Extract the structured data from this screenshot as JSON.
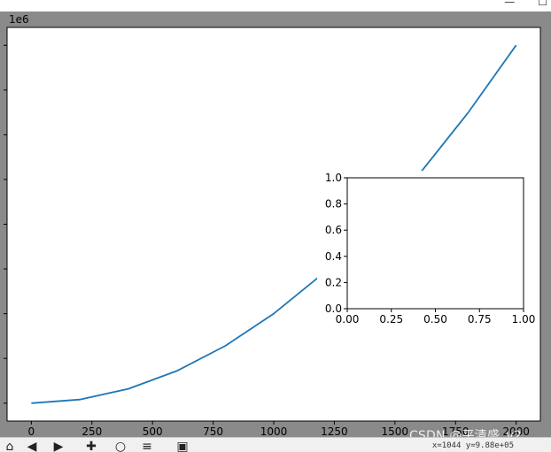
{
  "window": {
    "title": "​​​​",
    "controls": [
      "—",
      "☐"
    ]
  },
  "toolbar": {
    "buttons": [
      {
        "name": "home-icon",
        "glyph": "⌂"
      },
      {
        "name": "back-icon",
        "glyph": "◀"
      },
      {
        "name": "forward-icon",
        "glyph": "▶"
      },
      {
        "name": "pan-icon",
        "glyph": "✚"
      },
      {
        "name": "zoom-icon",
        "glyph": "○"
      },
      {
        "name": "configure-subplots-icon",
        "glyph": "≡"
      },
      {
        "name": "save-icon",
        "glyph": "▣"
      }
    ],
    "coord_text": "x=1044  y=9.88e+05"
  },
  "watermark": "CSDN @平清盛_v2",
  "chart_data": [
    {
      "type": "line",
      "x_ticks": [
        0,
        250,
        500,
        750,
        1000,
        1250,
        1500,
        1750,
        2000
      ],
      "x_tick_labels": [
        "0",
        "250",
        "500",
        "750",
        "1000",
        "1250",
        "1500",
        "1750",
        "2000"
      ],
      "y_ticks": [
        0,
        0.5,
        1,
        1.5,
        2,
        2.5,
        3,
        3.5,
        4
      ],
      "y_tick_labels": [
        "",
        "",
        "",
        "",
        "",
        "",
        "",
        "",
        ""
      ],
      "offset_text": "1e6",
      "xlim": [
        -100,
        2100
      ],
      "ylim": [
        -0.2,
        4.2
      ],
      "y_multiplier": 1000000,
      "series": [
        {
          "color": "#1f77b4",
          "x": [
            0,
            200,
            400,
            600,
            800,
            1000,
            1200,
            1400,
            1600,
            1800,
            2000
          ],
          "y": [
            0,
            0.04,
            0.16,
            0.36,
            0.64,
            1.0,
            1.44,
            1.96,
            2.56,
            3.24,
            4.0
          ]
        }
      ]
    },
    {
      "type": "line",
      "x_ticks": [
        0,
        0.25,
        0.5,
        0.75,
        1.0
      ],
      "x_tick_labels": [
        "0.00",
        "0.25",
        "0.50",
        "0.75",
        "1.00"
      ],
      "y_ticks": [
        0,
        0.2,
        0.4,
        0.6,
        0.8,
        1.0
      ],
      "y_tick_labels": [
        "0.0",
        "0.2",
        "0.4",
        "0.6",
        "0.8",
        "1.0"
      ],
      "xlim": [
        0,
        1
      ],
      "ylim": [
        0,
        1
      ],
      "series": []
    }
  ]
}
